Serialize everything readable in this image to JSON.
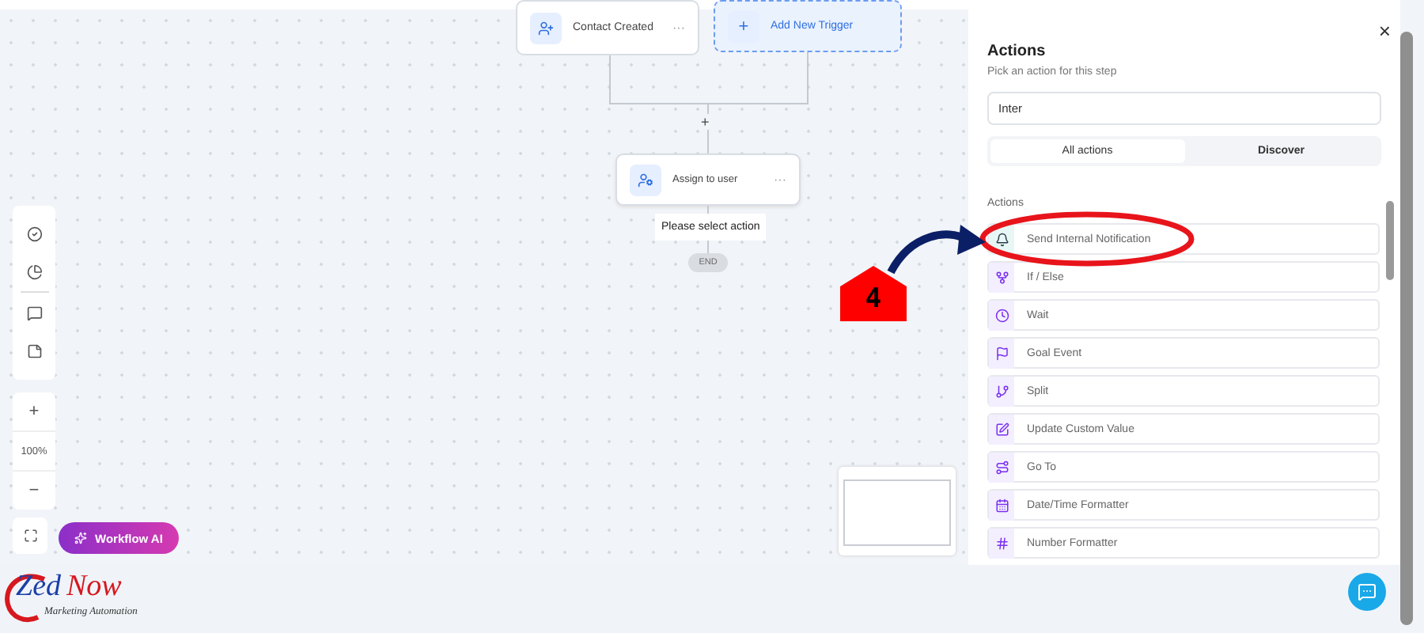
{
  "canvas": {
    "trigger": {
      "label": "Contact Created",
      "menu": "···"
    },
    "add_trigger": {
      "icon": "+",
      "label": "Add New Trigger"
    },
    "add_step": "+",
    "action_node": {
      "label": "Assign to user",
      "menu": "···"
    },
    "hint": "Please select action",
    "end": "END"
  },
  "zoom": {
    "zoom_in": "+",
    "level": "100%",
    "zoom_out": "−"
  },
  "ai_button": "Workflow AI",
  "panel": {
    "title": "Actions",
    "subtitle": "Pick an action for this step",
    "close": "×",
    "search": {
      "value": "Inter"
    },
    "tabs": [
      {
        "label": "All actions",
        "selected": true
      },
      {
        "label": "Discover",
        "selected": false
      }
    ],
    "section": "Actions",
    "items": [
      {
        "label": "Send Internal Notification",
        "kind": "notification",
        "highlighted": true
      },
      {
        "label": "If / Else",
        "kind": "branch",
        "highlighted": false
      },
      {
        "label": "Wait",
        "kind": "wait",
        "highlighted": false
      },
      {
        "label": "Goal Event",
        "kind": "goal",
        "highlighted": false
      },
      {
        "label": "Split",
        "kind": "split",
        "highlighted": false
      },
      {
        "label": "Update Custom Value",
        "kind": "edit",
        "highlighted": false
      },
      {
        "label": "Go To",
        "kind": "goto",
        "highlighted": false
      },
      {
        "label": "Date/Time Formatter",
        "kind": "date",
        "highlighted": false
      },
      {
        "label": "Number Formatter",
        "kind": "number",
        "highlighted": false
      }
    ]
  },
  "annotation": {
    "step": "4"
  },
  "logo": {
    "first": "Zed",
    "second": "Now",
    "tagline": "Marketing Automation"
  }
}
